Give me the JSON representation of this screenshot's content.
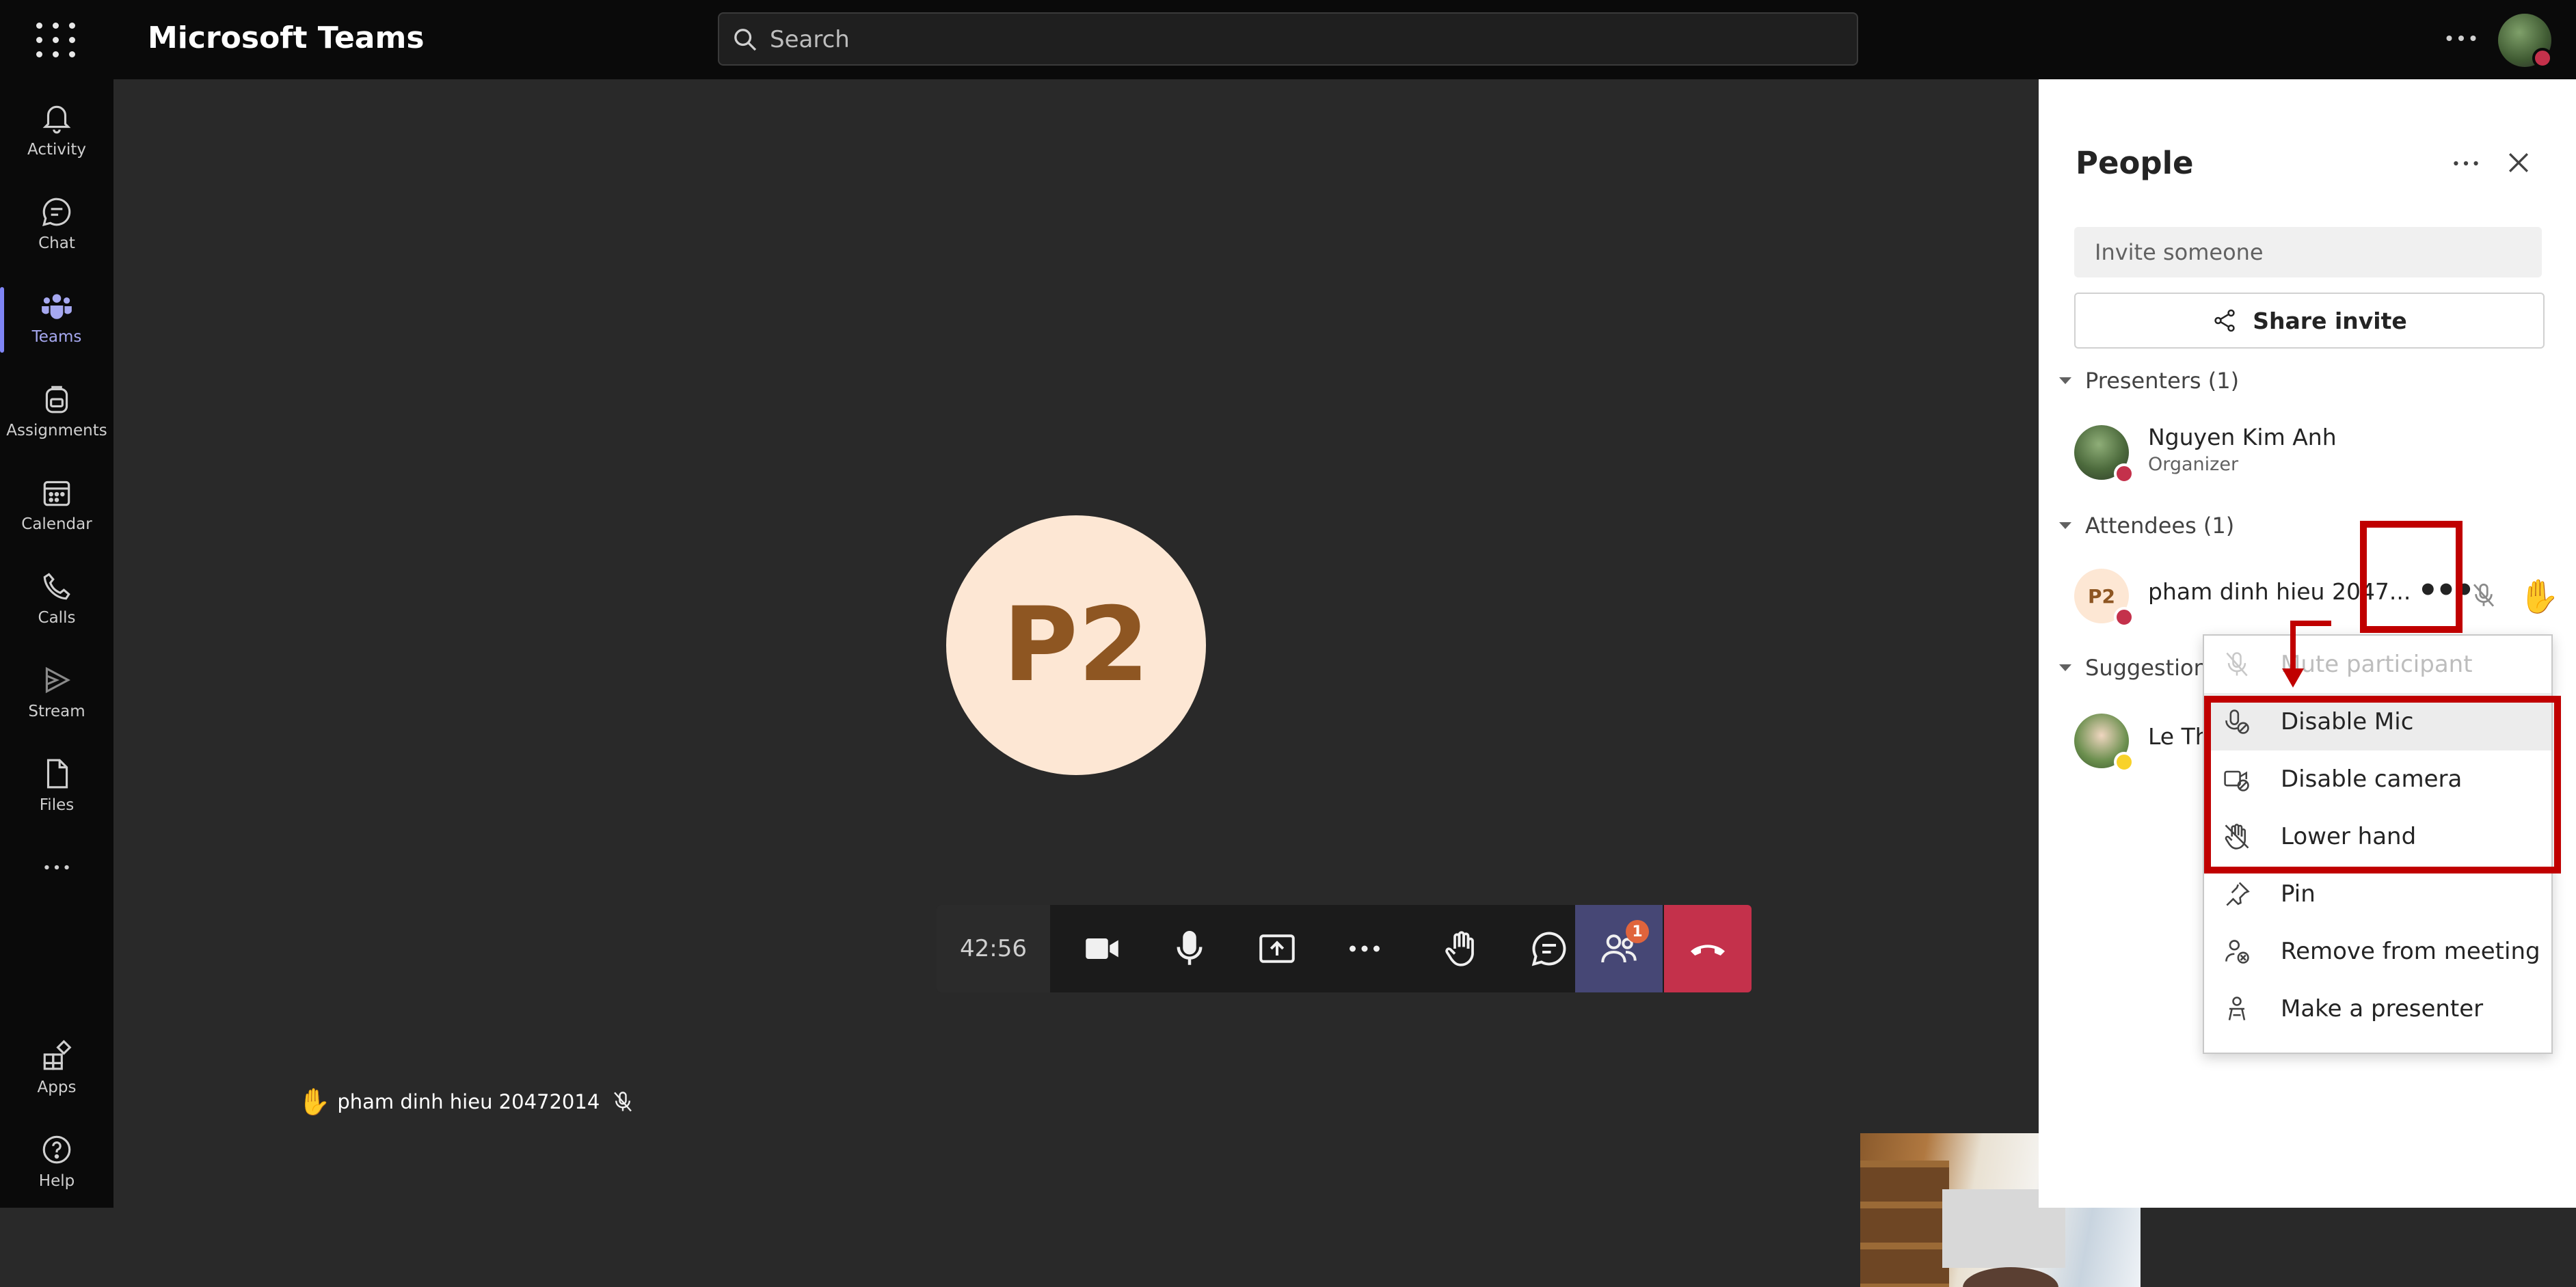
{
  "app": {
    "title": "Microsoft Teams"
  },
  "search": {
    "placeholder": "Search"
  },
  "rail": {
    "items": [
      {
        "label": "Activity"
      },
      {
        "label": "Chat"
      },
      {
        "label": "Teams"
      },
      {
        "label": "Assignments"
      },
      {
        "label": "Calendar"
      },
      {
        "label": "Calls"
      },
      {
        "label": "Stream"
      },
      {
        "label": "Files"
      }
    ],
    "apps": "Apps",
    "help": "Help"
  },
  "meeting": {
    "initials": "P2",
    "timer": "42:56",
    "people_badge": "1",
    "self_name": "pham dinh hieu 20472014"
  },
  "panel": {
    "title": "People",
    "invite_placeholder": "Invite someone",
    "share_invite": "Share invite",
    "presenters_header": "Presenters (1)",
    "presenter": {
      "name": "Nguyen Kim Anh",
      "role": "Organizer"
    },
    "attendees_header": "Attendees (1)",
    "attendee": {
      "initials": "P2",
      "name": "pham dinh hieu 2047..."
    },
    "suggestions_header": "Suggestions",
    "suggestion": {
      "name": "Le Th"
    }
  },
  "menu": {
    "items": [
      {
        "label": "Mute participant",
        "state": "disabled"
      },
      {
        "label": "Disable Mic"
      },
      {
        "label": "Disable camera"
      },
      {
        "label": "Lower hand"
      },
      {
        "label": "Pin"
      },
      {
        "label": "Remove from meeting"
      },
      {
        "label": "Make a presenter"
      }
    ]
  },
  "colors": {
    "accent": "#7f85f5",
    "hangup": "#c4314b",
    "annotation": "#c00000",
    "avatar_bg": "#fde7d4",
    "avatar_text": "#8e5622"
  }
}
